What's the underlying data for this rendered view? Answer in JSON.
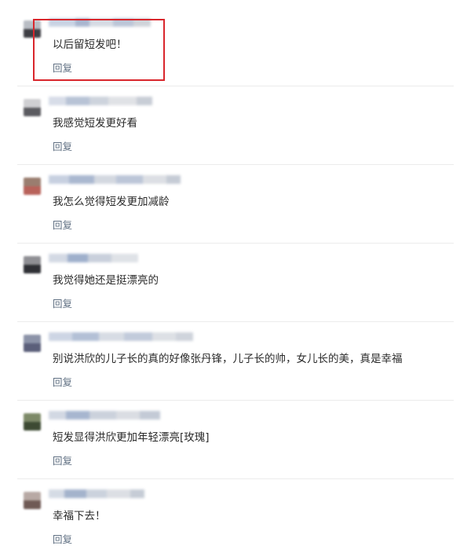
{
  "comments": [
    {
      "text": "以后留短发吧！",
      "reply_label": "回复"
    },
    {
      "text": "我感觉短发更好看",
      "reply_label": "回复"
    },
    {
      "text": "我怎么觉得短发更加减龄",
      "reply_label": "回复"
    },
    {
      "text": "我觉得她还是挺漂亮的",
      "reply_label": "回复"
    },
    {
      "text": "别说洪欣的儿子长的真的好像张丹锋，儿子长的帅，女儿长的美，真是幸福",
      "reply_label": "回复"
    },
    {
      "text": "短发显得洪欣更加年轻漂亮[玫瑰]",
      "reply_label": "回复"
    },
    {
      "text": "幸福下去！",
      "reply_label": "回复"
    }
  ],
  "colors": {
    "highlight_border": "#d9262c",
    "reply_link": "#5f6f82",
    "comment_text": "#2b2b2b"
  },
  "blurred_regions": "usernames and avatars are pixelated/obscured in the original"
}
